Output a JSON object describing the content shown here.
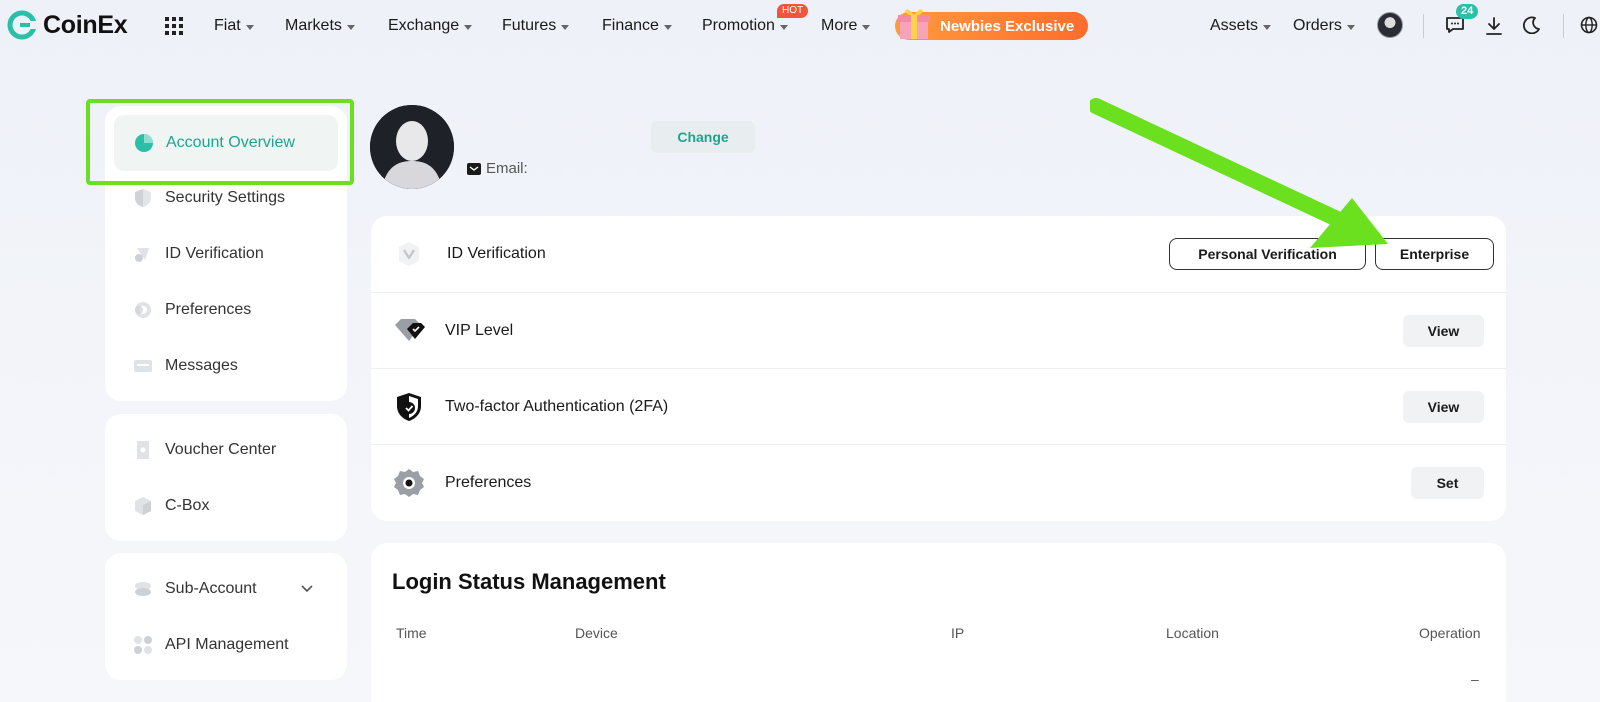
{
  "brand": {
    "name": "CoinEx",
    "accent": "#1fa58f"
  },
  "topnav": {
    "items": [
      {
        "label": "Fiat"
      },
      {
        "label": "Markets"
      },
      {
        "label": "Exchange"
      },
      {
        "label": "Futures"
      },
      {
        "label": "Finance"
      },
      {
        "label": "Promotion"
      },
      {
        "label": "More"
      }
    ],
    "hot_badge": "HOT",
    "newbies_label": "Newbies Exclusive",
    "assets_label": "Assets",
    "orders_label": "Orders",
    "message_count": "24"
  },
  "sidebar": {
    "group1": [
      {
        "label": "Account Overview",
        "icon": "pie-chart-icon",
        "active": true
      },
      {
        "label": "Security Settings",
        "icon": "shield-icon"
      },
      {
        "label": "ID Verification",
        "icon": "id-badge-icon"
      },
      {
        "label": "Preferences",
        "icon": "gear-icon"
      },
      {
        "label": "Messages",
        "icon": "message-icon"
      }
    ],
    "group2": [
      {
        "label": "Voucher Center",
        "icon": "voucher-icon"
      },
      {
        "label": "C-Box",
        "icon": "box-icon"
      }
    ],
    "group3": [
      {
        "label": "Sub-Account",
        "icon": "layers-icon"
      },
      {
        "label": "API Management",
        "icon": "api-icon"
      }
    ]
  },
  "profile": {
    "change_label": "Change",
    "email_label": "Email:"
  },
  "settings": {
    "rows": [
      {
        "label": "ID Verification",
        "icon": "id-verification-icon"
      },
      {
        "label": "VIP Level",
        "icon": "vip-diamond-icon",
        "button": "View"
      },
      {
        "label": "Two-factor Authentication (2FA)",
        "icon": "shield-check-icon",
        "button": "View"
      },
      {
        "label": "Preferences",
        "icon": "gear-icon",
        "button": "Set"
      }
    ],
    "personal_verification_label": "Personal Verification",
    "enterprise_label": "Enterprise"
  },
  "login": {
    "title": "Login Status Management",
    "columns": [
      "Time",
      "Device",
      "IP",
      "Location",
      "Operation"
    ],
    "empty": "–"
  },
  "colors": {
    "highlight_green": "#6be01e",
    "hot_red": "#f2543c",
    "newbies_orange": "#ff7a30"
  }
}
